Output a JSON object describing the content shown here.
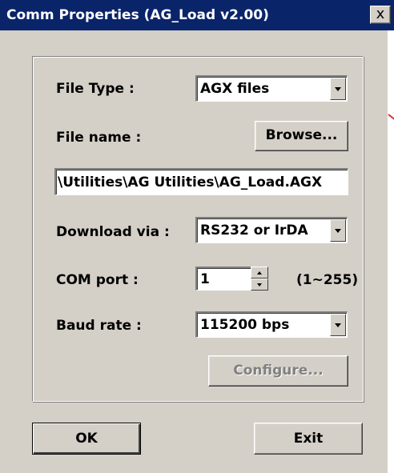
{
  "window": {
    "title": "Comm Properties (AG_Load v2.00)",
    "close_glyph": "x"
  },
  "form": {
    "file_type": {
      "label": "File Type :",
      "value": "AGX files"
    },
    "file_name": {
      "label": "File name :",
      "browse_label": "Browse...",
      "path": "\\Utilities\\AG Utilities\\AG_Load.AGX"
    },
    "download_via": {
      "label": "Download via :",
      "value": "RS232 or IrDA"
    },
    "com_port": {
      "label": "COM port :",
      "value": "1",
      "range": "(1~255)"
    },
    "baud_rate": {
      "label": "Baud rate :",
      "value": "115200 bps"
    },
    "configure_label": "Configure..."
  },
  "footer": {
    "ok_label": "OK",
    "exit_label": "Exit"
  },
  "colors": {
    "titlebar": "#0a246a",
    "face": "#d4d0c8",
    "accent_mark": "#e03030"
  }
}
